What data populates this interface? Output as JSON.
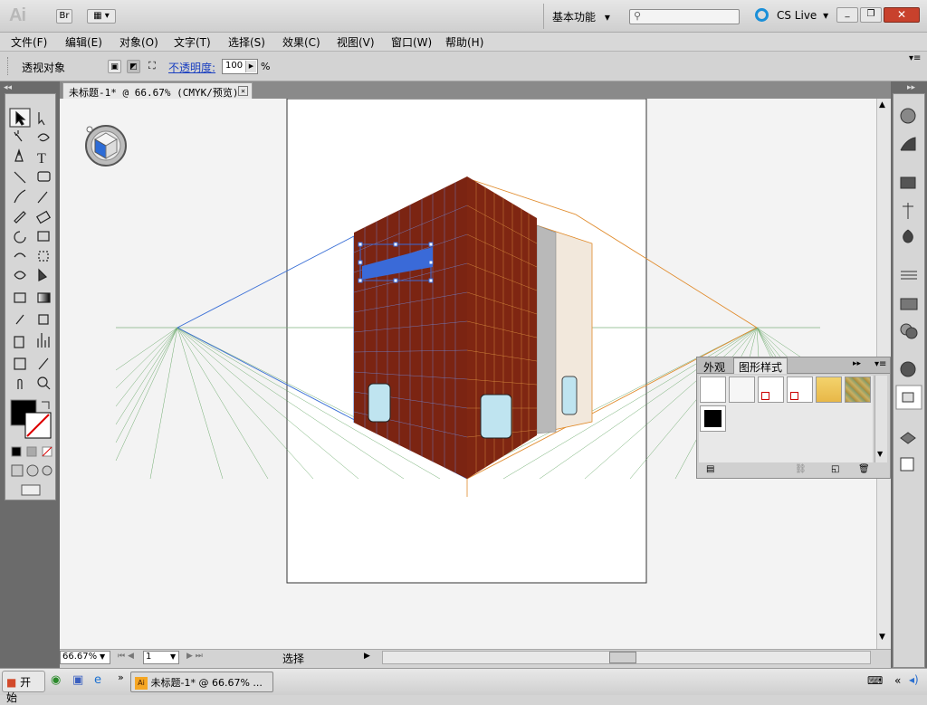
{
  "app": {
    "logo": "Ai",
    "bridge_label": "Br",
    "workspace_label": "基本功能",
    "search_placeholder": "",
    "cs_live_label": "CS Live"
  },
  "menu": {
    "items": [
      "文件(F)",
      "编辑(E)",
      "对象(O)",
      "文字(T)",
      "选择(S)",
      "效果(C)",
      "视图(V)",
      "窗口(W)",
      "帮助(H)"
    ]
  },
  "control_bar": {
    "object_label": "透视对象",
    "opacity_label": "不透明度:",
    "opacity_value": "100",
    "opacity_unit": "%"
  },
  "document": {
    "tab_title": "未标题-1* @ 66.67% (CMYK/预览)"
  },
  "status": {
    "zoom_value": "66.67%",
    "page_value": "1",
    "status_text": "选择"
  },
  "panel": {
    "tab_appearance": "外观",
    "tab_graphic_styles": "图形样式"
  },
  "taskbar": {
    "start_label": "开始",
    "task_item": "未标题-1* @ 66.67% ..."
  },
  "colors": {
    "building_front": "#7b2412",
    "grid_left": "#3a6fd6",
    "grid_right": "#e08a2a",
    "ground_grid": "#4f9a4f",
    "accent_blue": "#3a6ad8"
  }
}
